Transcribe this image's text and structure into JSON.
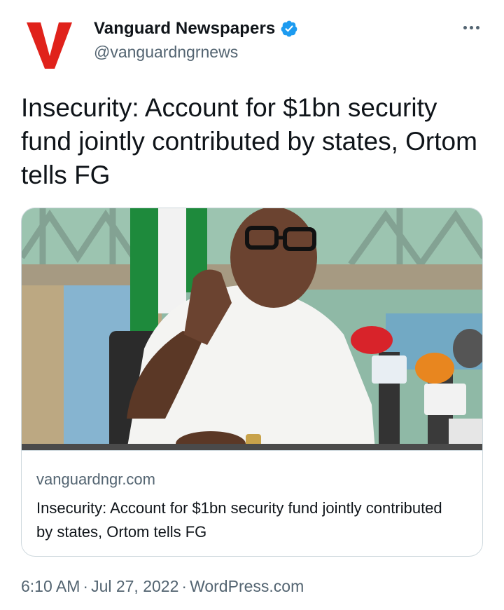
{
  "tweet": {
    "author": {
      "display_name": "Vanguard Newspapers",
      "handle": "@vanguardngrnews",
      "verified": true,
      "avatar_icon": "vanguard-v-logo",
      "logo_color": "#e0221b"
    },
    "more_icon": "more-horizontal-icon",
    "text": "Insecurity: Account for $1bn security fund jointly contributed by states, Ortom tells FG",
    "card": {
      "image_icon": "news-photo-speaker-at-microphones",
      "domain": "vanguardngr.com",
      "title": "Insecurity: Account for $1bn security fund jointly contributed by states, Ortom tells FG"
    },
    "meta": {
      "time": "6:10 AM",
      "separator": "·",
      "date": "Jul 27, 2022",
      "source": "WordPress.com"
    }
  },
  "colors": {
    "text_primary": "#0f1419",
    "text_secondary": "#536471",
    "verified_blue": "#1d9bf0",
    "border": "#cfd9de"
  }
}
